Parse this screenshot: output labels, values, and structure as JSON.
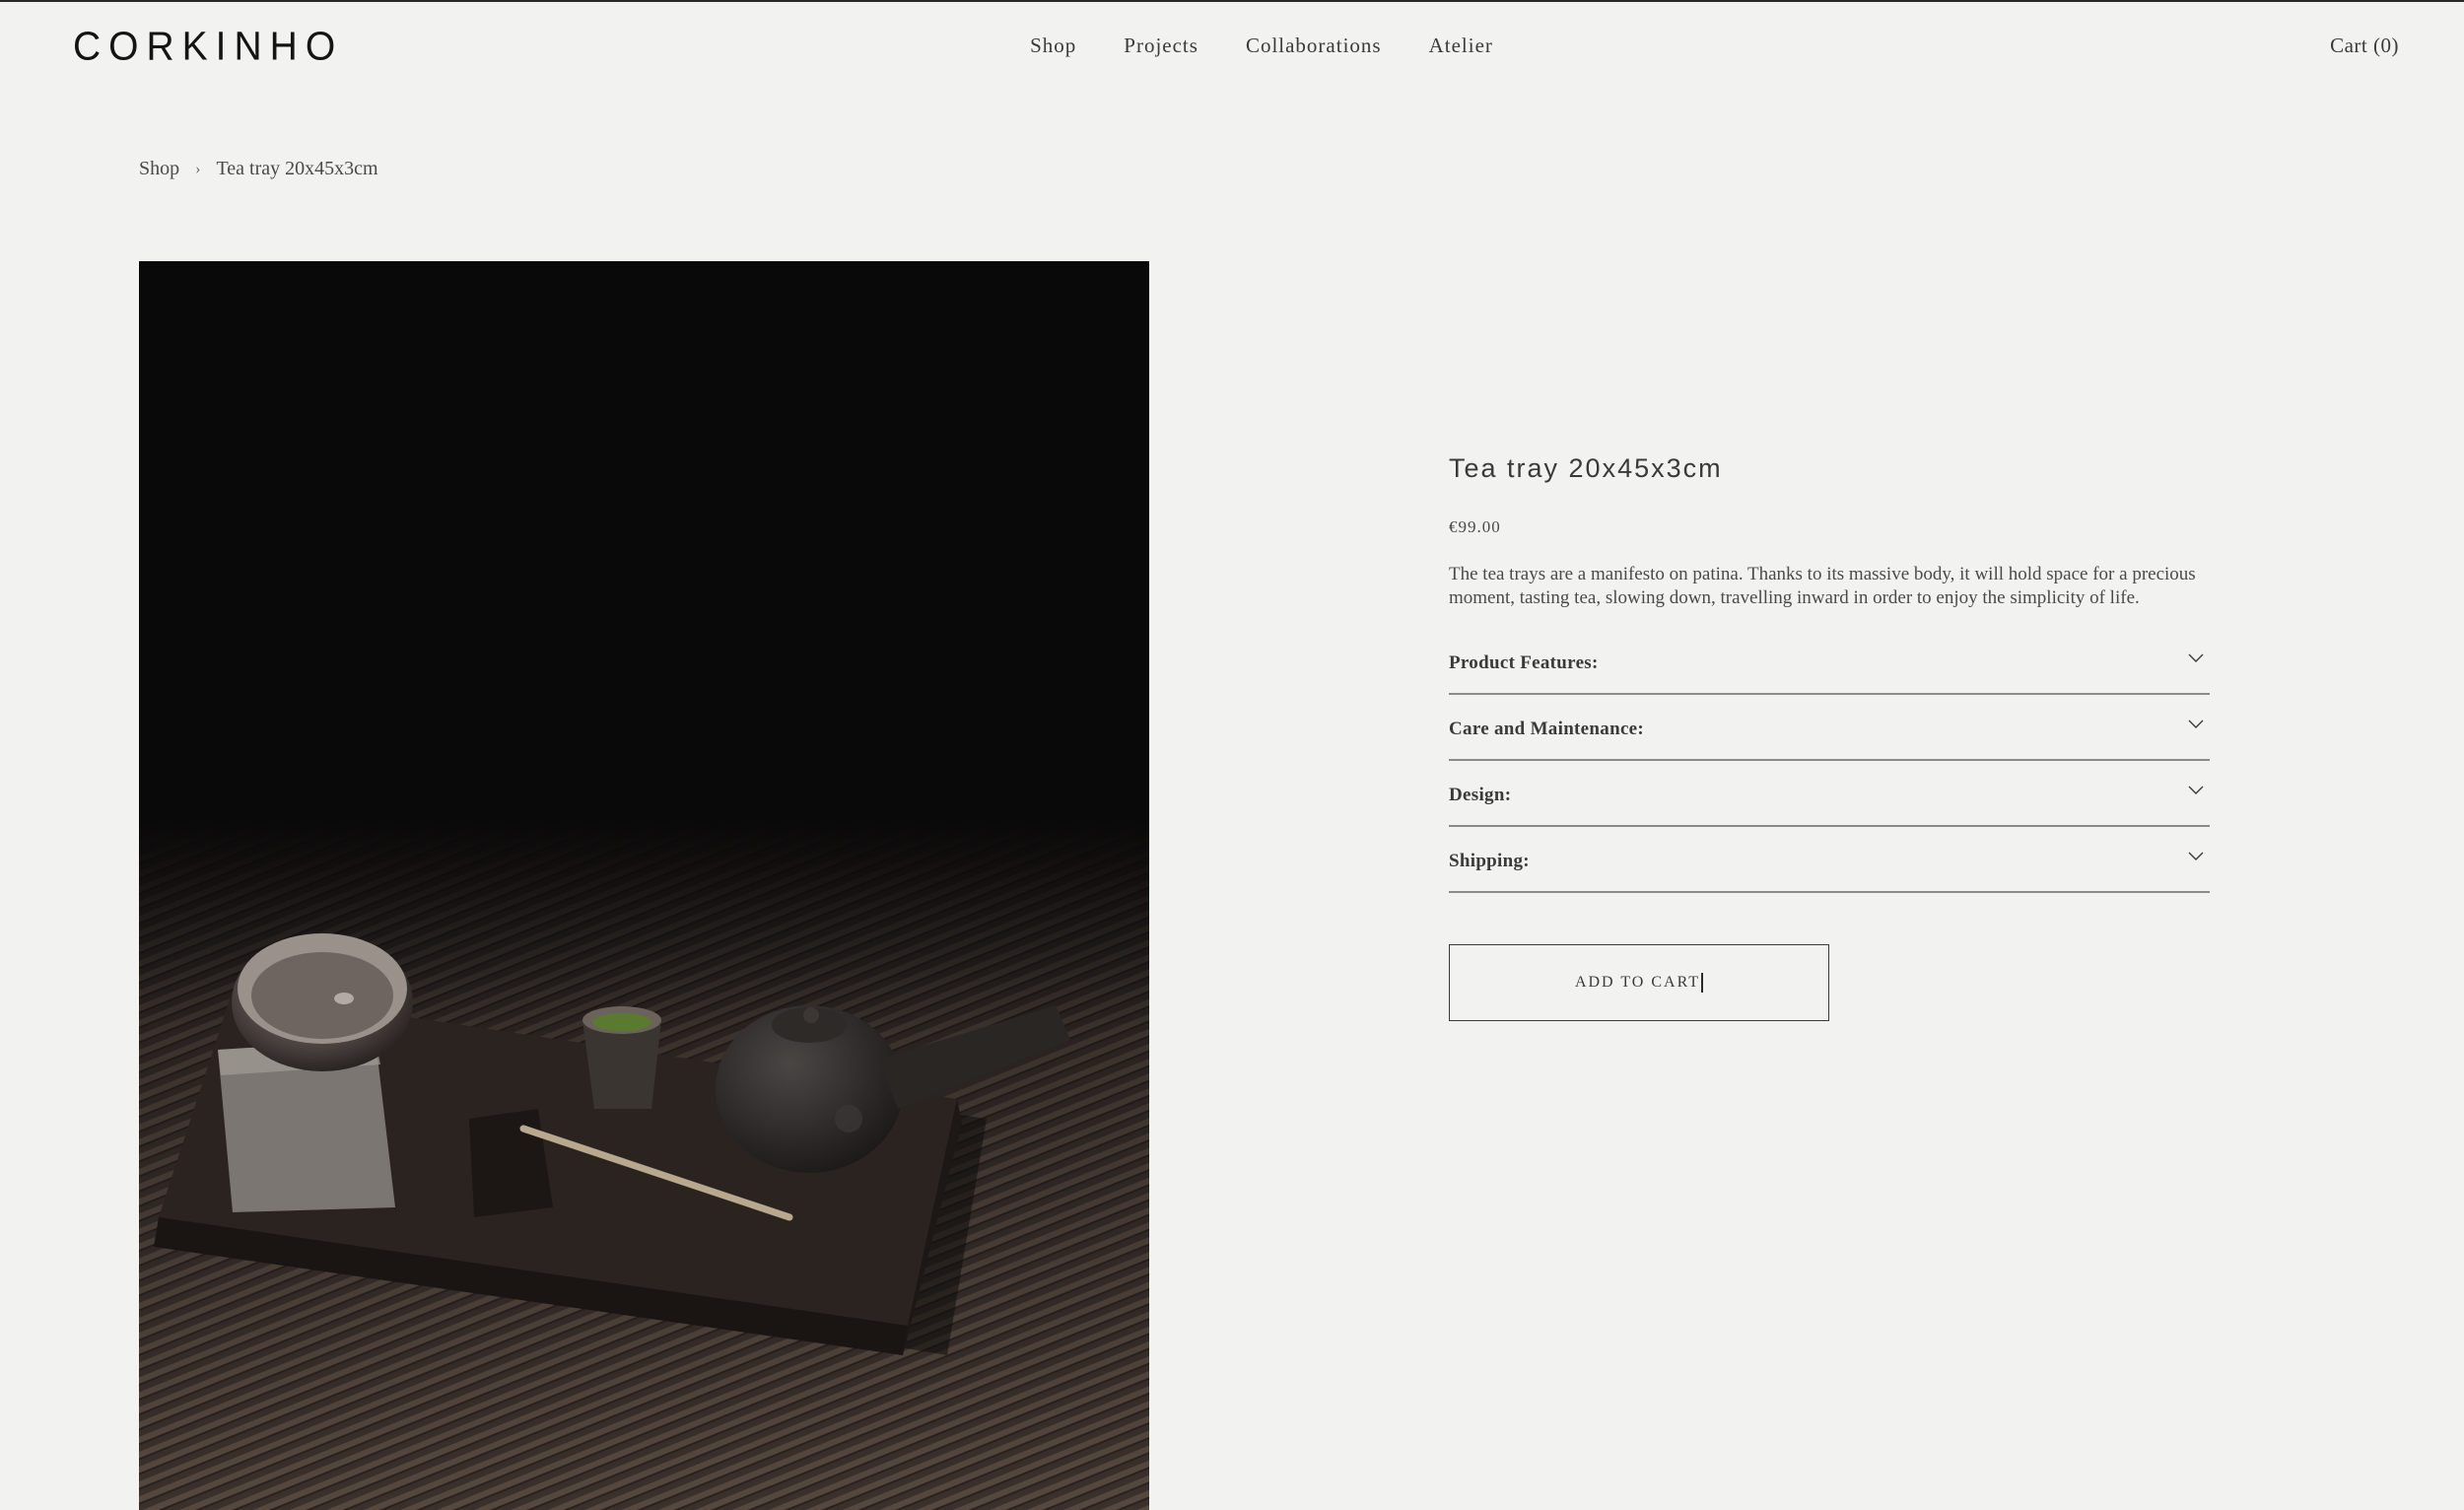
{
  "header": {
    "logo": "CORKINHO",
    "nav": [
      {
        "label": "Shop"
      },
      {
        "label": "Projects"
      },
      {
        "label": "Collaborations"
      },
      {
        "label": "Atelier"
      }
    ],
    "cart_label": "Cart (0)"
  },
  "breadcrumb": {
    "root": "Shop",
    "separator": "›",
    "current": "Tea tray 20x45x3cm"
  },
  "product": {
    "title": "Tea tray 20x45x3cm",
    "price": "€99.00",
    "description": "The tea trays are a manifesto on patina. Thanks to its massive body, it will hold space for a precious moment, tasting tea, slowing down, travelling inward in order to enjoy the simplicity of life.",
    "sections": [
      {
        "label": "Product Features:"
      },
      {
        "label": "Care and Maintenance:"
      },
      {
        "label": "Design:"
      },
      {
        "label": "Shipping:"
      }
    ],
    "add_to_cart_label": "ADD TO CART"
  },
  "colors": {
    "background": "#f2f2f0",
    "text": "#3a3a38",
    "logo": "#141414",
    "divider": "#8a8a88"
  },
  "icons": {
    "accordion": "chevron-down-icon"
  }
}
